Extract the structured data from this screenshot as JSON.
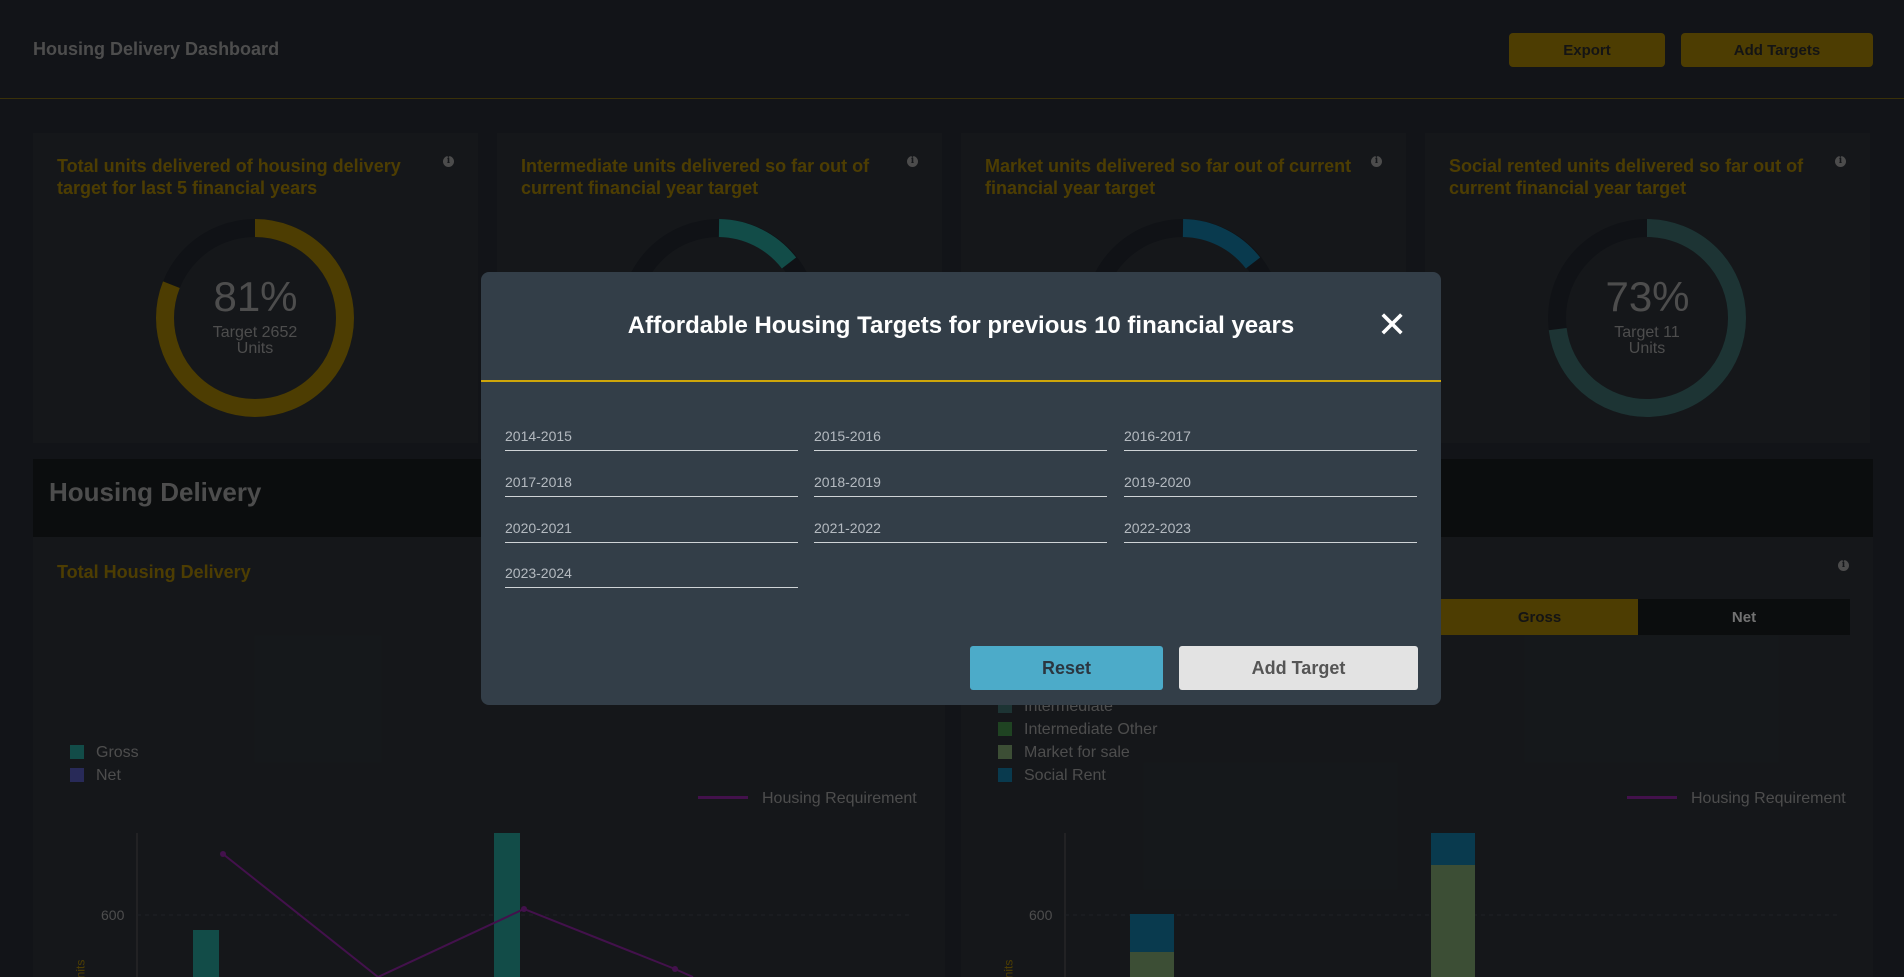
{
  "header": {
    "title": "Housing Delivery Dashboard",
    "export_label": "Export",
    "add_targets_label": "Add Targets"
  },
  "cards": [
    {
      "title": "Total units delivered of housing delivery target for last 5 financial years",
      "percent": "81%",
      "target": "Target 2652",
      "unit": "Units",
      "fraction": 0.81,
      "color": "#8c7004"
    },
    {
      "title": "Intermediate units delivered so far out of current financial year target",
      "color": "#218a84"
    },
    {
      "title": "Market units delivered so far out of current financial year target",
      "color": "#116b8e"
    },
    {
      "title": "Social rented units delivered so far out of current financial year target",
      "percent": "73%",
      "target": "Target 11",
      "unit": "Units",
      "fraction": 0.73,
      "color": "#35605f"
    }
  ],
  "section": {
    "title": "Housing Delivery"
  },
  "left_panel": {
    "title": "Total Housing Delivery",
    "legend": [
      {
        "label": "Gross",
        "color": "#218a84"
      },
      {
        "label": "Net",
        "color": "#4a4ea0"
      }
    ],
    "requirement_label": "Housing Requirement",
    "y_tick": "600",
    "y_axis_label": "nits"
  },
  "right_panel": {
    "toggle_gross": "Gross",
    "toggle_net": "Net",
    "legend": [
      {
        "label": "Intermediate",
        "color": "#35605f"
      },
      {
        "label": "Intermediate Other",
        "color": "#3a7a3f"
      },
      {
        "label": "Market for sale",
        "color": "#6e8e62"
      },
      {
        "label": "Social Rent",
        "color": "#116b8e"
      }
    ],
    "requirement_label": "Housing Requirement",
    "y_tick": "600",
    "y_axis_label": "nits"
  },
  "modal": {
    "title": "Affordable Housing Targets for previous 10 financial years",
    "close_symbol": "✕",
    "fields": [
      "2014-2015",
      "2015-2016",
      "2016-2017",
      "2017-2018",
      "2018-2019",
      "2019-2020",
      "2020-2021",
      "2021-2022",
      "2022-2023",
      "2023-2024"
    ],
    "reset_label": "Reset",
    "add_label": "Add Target"
  }
}
